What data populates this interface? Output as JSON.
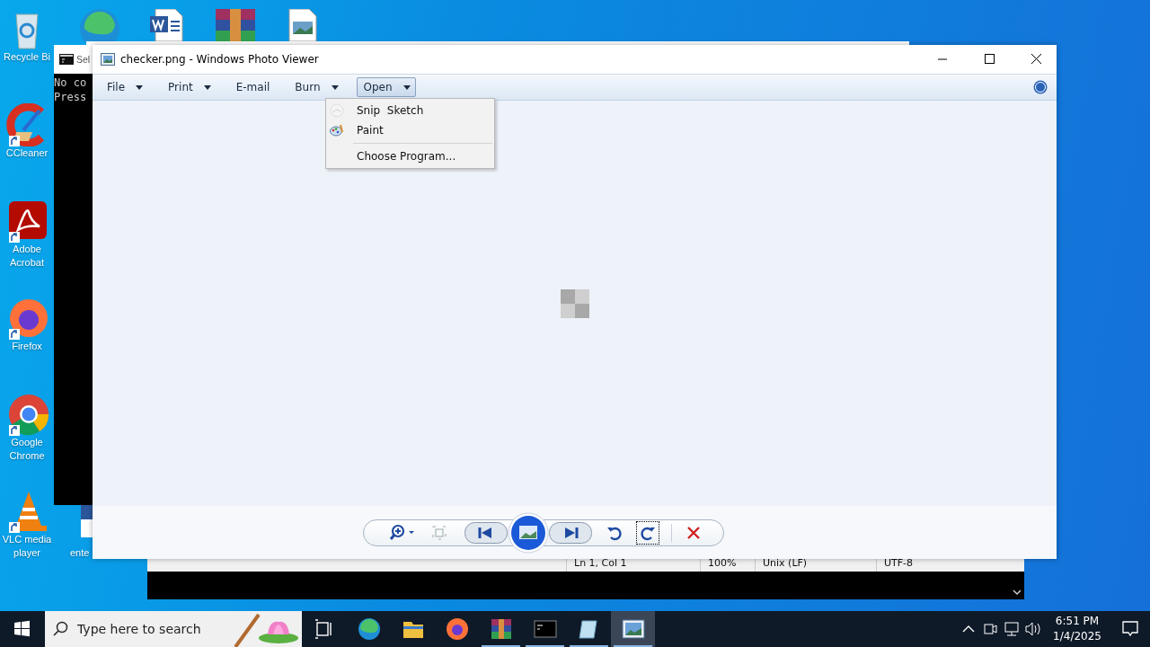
{
  "desktop": {
    "icons": [
      {
        "label": "Recycle Bi",
        "shortcut": false
      },
      {
        "label": "CCleaner",
        "shortcut": true
      },
      {
        "label": "Adobe Acrobat",
        "shortcut": true
      },
      {
        "label": "Firefox",
        "shortcut": true
      },
      {
        "label": "Google Chrome",
        "shortcut": true
      },
      {
        "label": "VLC media player",
        "shortcut": true
      },
      {
        "label": "ente",
        "shortcut": false
      }
    ]
  },
  "console_window": {
    "title": "Sel",
    "lines": [
      "No co",
      "Press"
    ]
  },
  "notepad_window": {
    "status_bar": [
      "Ln 1, Col 1",
      "100%",
      "Unix (LF)",
      "UTF-8"
    ]
  },
  "photo_viewer": {
    "title": "checker.png - Windows Photo Viewer",
    "toolbar": [
      {
        "label": "File",
        "dropdown": true,
        "selected": false
      },
      {
        "label": "Print",
        "dropdown": true,
        "selected": false
      },
      {
        "label": "E-mail",
        "dropdown": false,
        "selected": false
      },
      {
        "label": "Burn",
        "dropdown": true,
        "selected": false
      },
      {
        "label": "Open",
        "dropdown": true,
        "selected": true
      }
    ],
    "open_menu": {
      "apps": [
        "Snip  Sketch",
        "Paint"
      ],
      "commands": [
        "Choose Program..."
      ]
    }
  },
  "taskbar": {
    "search": {
      "placeholder": "Type here to search"
    },
    "apps": [
      {
        "running": false,
        "selected": false
      },
      {
        "running": false,
        "selected": false
      },
      {
        "running": false,
        "selected": false
      },
      {
        "running": true,
        "selected": false
      },
      {
        "running": true,
        "selected": false
      },
      {
        "running": true,
        "selected": false
      },
      {
        "running": true,
        "selected": true
      }
    ],
    "clock": {
      "time": "6:51 PM",
      "date": "1/4/2025"
    }
  }
}
